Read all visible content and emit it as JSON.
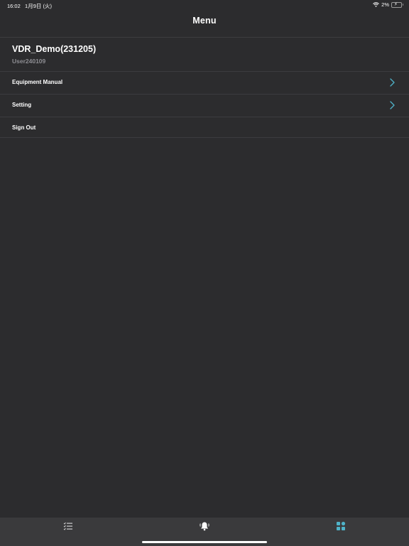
{
  "status_bar": {
    "time": "16:02",
    "date": "1月9日 (火)",
    "battery_percent": "2%"
  },
  "nav": {
    "title": "Menu"
  },
  "account": {
    "name": "VDR_Demo(231205)",
    "user": "User240109"
  },
  "menu": {
    "items": [
      {
        "label": "Equipment Manual",
        "has_chevron": true
      },
      {
        "label": "Setting",
        "has_chevron": true
      },
      {
        "label": "Sign Out",
        "has_chevron": false
      }
    ]
  },
  "tab_bar": {
    "tabs": [
      {
        "icon": "checklist-icon",
        "selected": false
      },
      {
        "icon": "bell-icon",
        "selected": false
      },
      {
        "icon": "grid-icon",
        "selected": true
      }
    ]
  },
  "colors": {
    "background": "#2c2c2e",
    "accent": "#4fb3c9",
    "tab_bar": "#3a3a3c",
    "secondary_text": "#8e8e93"
  }
}
